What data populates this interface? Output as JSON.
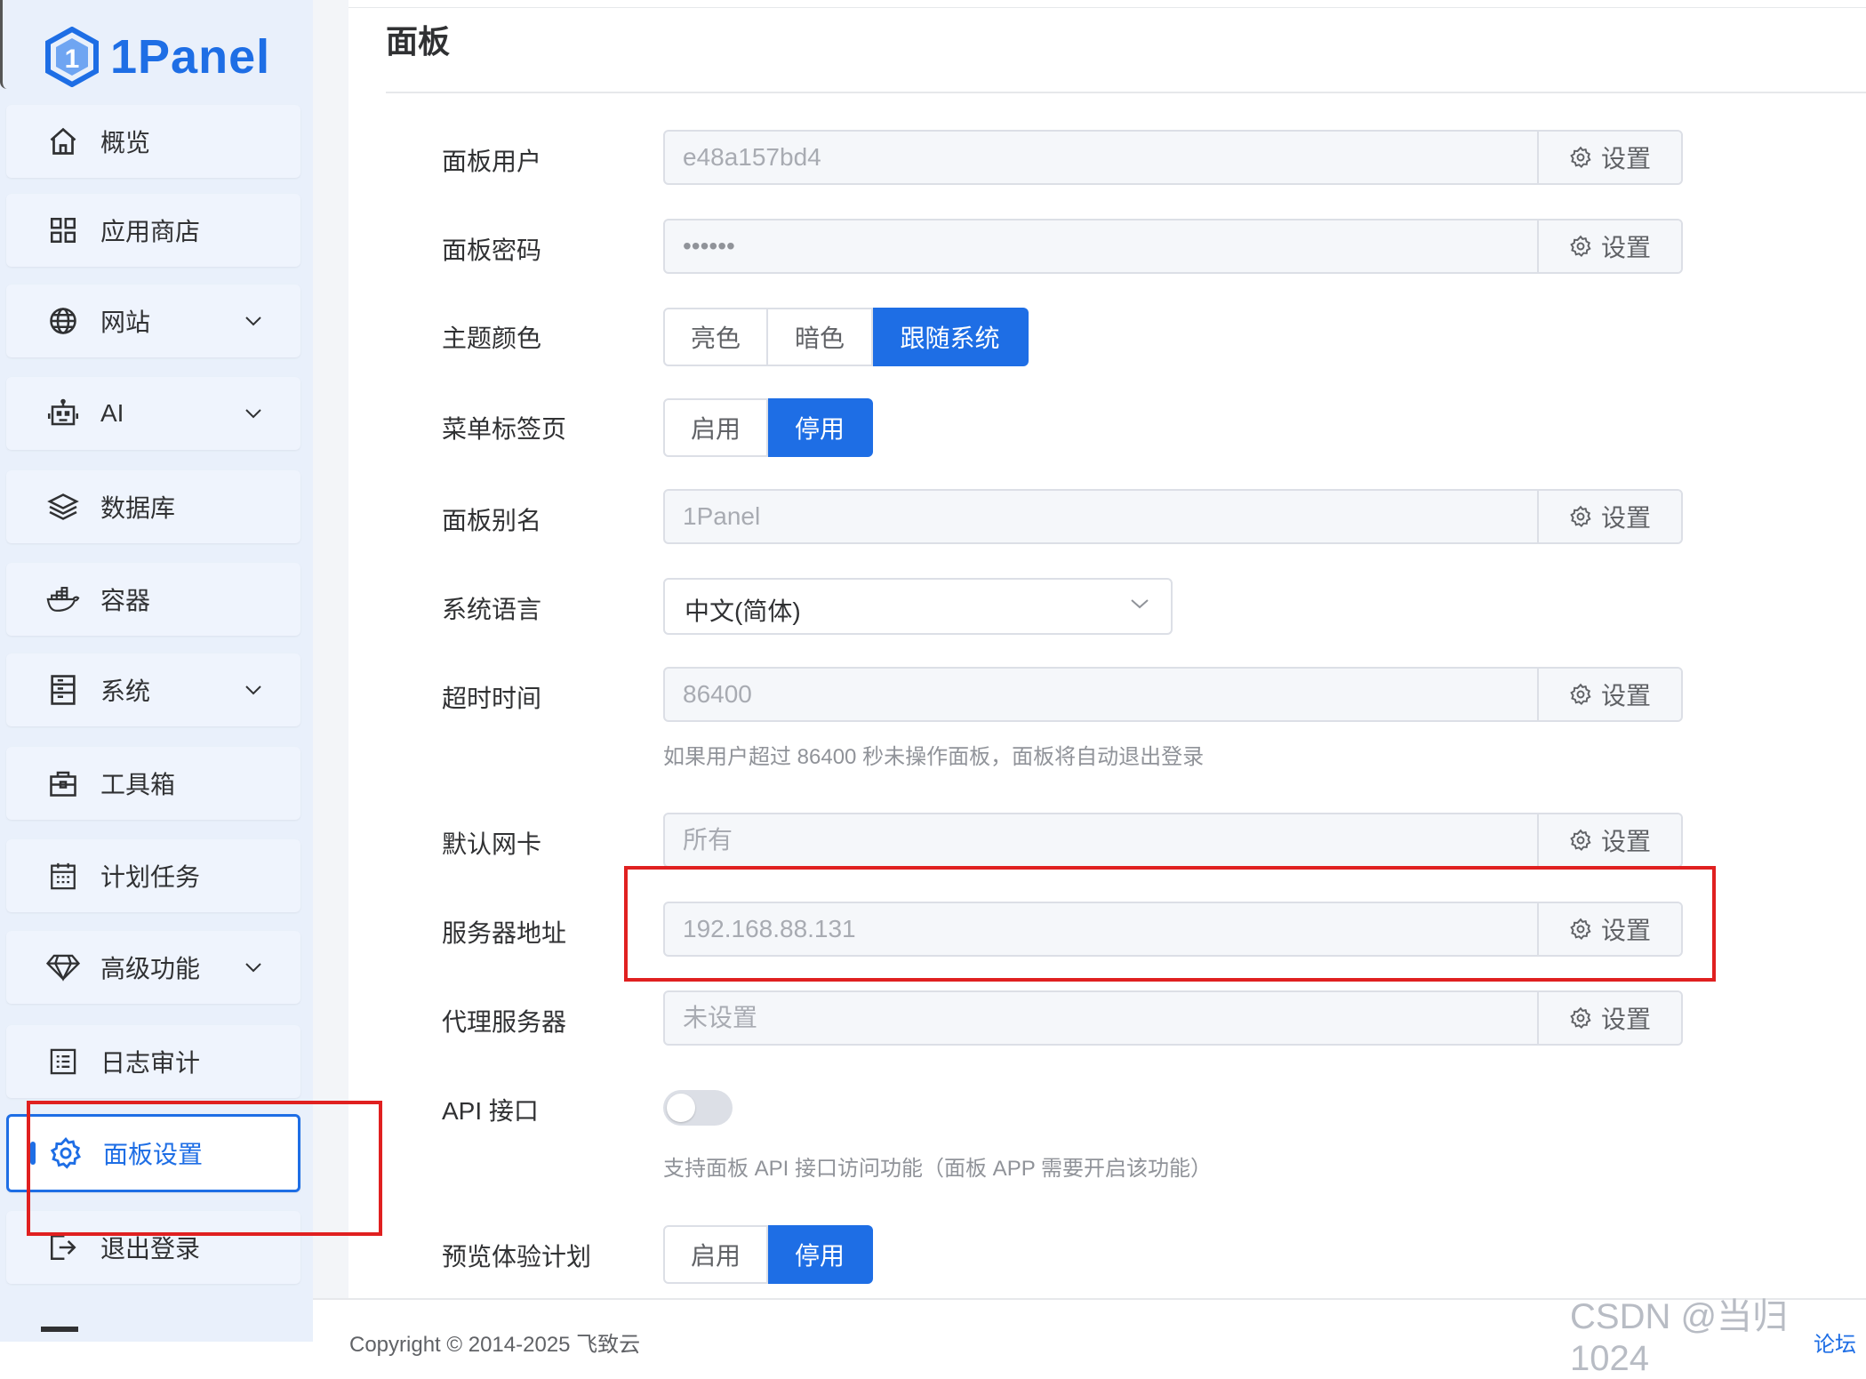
{
  "brand": {
    "name": "1Panel",
    "accent": "#1e6ee5"
  },
  "sidebar": {
    "items": [
      {
        "label": "概览",
        "icon": "home-icon"
      },
      {
        "label": "应用商店",
        "icon": "grid-icon"
      },
      {
        "label": "网站",
        "icon": "globe-icon",
        "expandable": true
      },
      {
        "label": "AI",
        "icon": "robot-icon",
        "expandable": true
      },
      {
        "label": "数据库",
        "icon": "layers-icon"
      },
      {
        "label": "容器",
        "icon": "docker-icon"
      },
      {
        "label": "系统",
        "icon": "server-icon",
        "expandable": true
      },
      {
        "label": "工具箱",
        "icon": "toolbox-icon"
      },
      {
        "label": "计划任务",
        "icon": "calendar-icon"
      },
      {
        "label": "高级功能",
        "icon": "diamond-icon",
        "expandable": true
      },
      {
        "label": "日志审计",
        "icon": "log-icon"
      },
      {
        "label": "面板设置",
        "icon": "gear-icon",
        "active": true
      },
      {
        "label": "退出登录",
        "icon": "logout-icon"
      }
    ]
  },
  "main": {
    "title": "面板",
    "set_label": "设置",
    "fields": {
      "user": {
        "label": "面板用户",
        "value": "e48a157bd4"
      },
      "password": {
        "label": "面板密码",
        "value": "••••••"
      },
      "theme": {
        "label": "主题颜色",
        "options": [
          "亮色",
          "暗色",
          "跟随系统"
        ],
        "selected": "跟随系统"
      },
      "menu_tabs": {
        "label": "菜单标签页",
        "options": [
          "启用",
          "停用"
        ],
        "selected": "停用"
      },
      "alias": {
        "label": "面板别名",
        "value": "1Panel"
      },
      "language": {
        "label": "系统语言",
        "value": "中文(简体)"
      },
      "timeout": {
        "label": "超时时间",
        "value": "86400",
        "hint": "如果用户超过 86400 秒未操作面板，面板将自动退出登录"
      },
      "nic": {
        "label": "默认网卡",
        "value": "所有"
      },
      "server_addr": {
        "label": "服务器地址",
        "value": "192.168.88.131"
      },
      "proxy": {
        "label": "代理服务器",
        "value": "未设置"
      },
      "api": {
        "label": "API 接口",
        "enabled": false,
        "hint": "支持面板 API 接口访问功能（面板 APP 需要开启该功能）"
      },
      "preview": {
        "label": "预览体验计划",
        "options": [
          "启用",
          "停用"
        ],
        "selected": "停用"
      }
    }
  },
  "footer": {
    "copyright": "Copyright © 2014-2025 飞致云",
    "forum": "论坛",
    "watermark": "CSDN @当归1024"
  }
}
